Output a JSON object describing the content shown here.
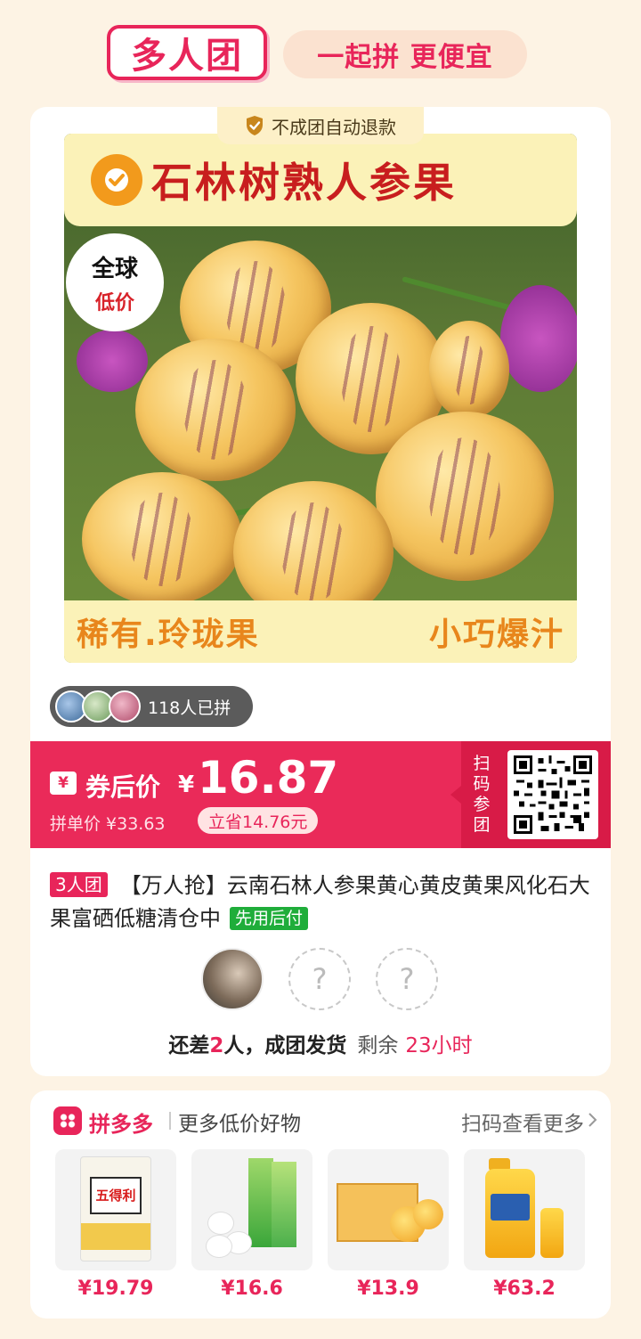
{
  "header": {
    "brand": "多人团",
    "slogan": "一起拼 更便宜"
  },
  "product": {
    "refund_tag": "不成团自动退款",
    "image": {
      "title": "石林树熟人参果",
      "badge_line1": "全球",
      "badge_line2": "低价",
      "bottom_left": "稀有.玲珑果",
      "bottom_right": "小巧爆汁"
    },
    "joined_text": "118人已拼",
    "price": {
      "coupon_icon": "¥",
      "after_coupon_label": "券后价",
      "currency": "¥",
      "value": "16.87",
      "group_price": "拼单价 ¥33.63",
      "save": "立省14.76元"
    },
    "scan_to_join": "扫码参团",
    "group_tag": "3人团",
    "description": "【万人抢】云南石林人参果黄心黄皮黄果风化石大果富硒低糖清仓中",
    "pay_later_tag": "先用后付",
    "empty_slot_mark": "?",
    "status": {
      "prefix": "还差",
      "missing": "2",
      "suffix": "人，成团发货",
      "remaining_label": "剩余",
      "remaining_time": "23小时"
    }
  },
  "recommend": {
    "brand": "拼多多",
    "subtitle": "更多低价好物",
    "scan_more": "扫码查看更多",
    "items": [
      {
        "price": "¥19.79",
        "pack_label": "五得利",
        "icon": "flour-bag-icon"
      },
      {
        "price": "¥16.6",
        "icon": "tissue-pack-icon"
      },
      {
        "price": "¥13.9",
        "icon": "orange-box-icon"
      },
      {
        "price": "¥63.2",
        "icon": "oil-bottle-icon"
      }
    ]
  },
  "colors": {
    "accent": "#e8255a",
    "price_banner": "#ea2a59",
    "pay_later": "#1fad3a",
    "background": "#fdf3e4"
  }
}
